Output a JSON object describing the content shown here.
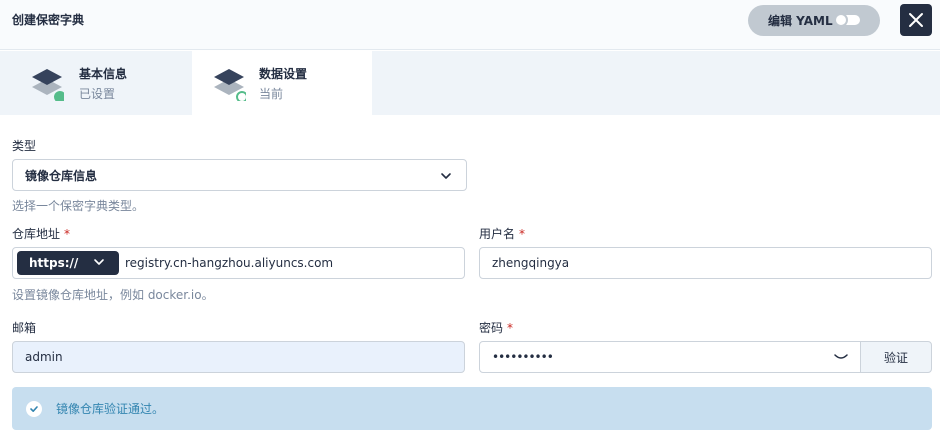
{
  "header": {
    "title": "创建保密字典",
    "yaml_label": "编辑 YAML"
  },
  "steps": [
    {
      "name": "基本信息",
      "status": "已设置"
    },
    {
      "name": "数据设置",
      "status": "当前"
    }
  ],
  "form": {
    "type": {
      "label": "类型",
      "value": "镜像仓库信息",
      "hint": "选择一个保密字典类型。"
    },
    "registry": {
      "label": "仓库地址",
      "protocol": "https://",
      "value": "registry.cn-hangzhou.aliyuncs.com",
      "hint": "设置镜像仓库地址，例如 docker.io。"
    },
    "username": {
      "label": "用户名",
      "value": "zhengqingya"
    },
    "email": {
      "label": "邮箱",
      "value": "admin"
    },
    "password": {
      "label": "密码",
      "value": "••••••••••",
      "verify_label": "验证"
    },
    "required_mark": "*"
  },
  "alert": {
    "text": "镜像仓库验证通过。"
  },
  "colors": {
    "dark": "#242e42",
    "success": "#55bc8a",
    "info_bg": "#c7deef",
    "info_text": "#3385b0",
    "required": "#ca2621"
  },
  "icons": [
    "close-icon",
    "step-layers-icon",
    "chevron-down-icon",
    "eye-closed-icon",
    "check-circle-icon"
  ]
}
